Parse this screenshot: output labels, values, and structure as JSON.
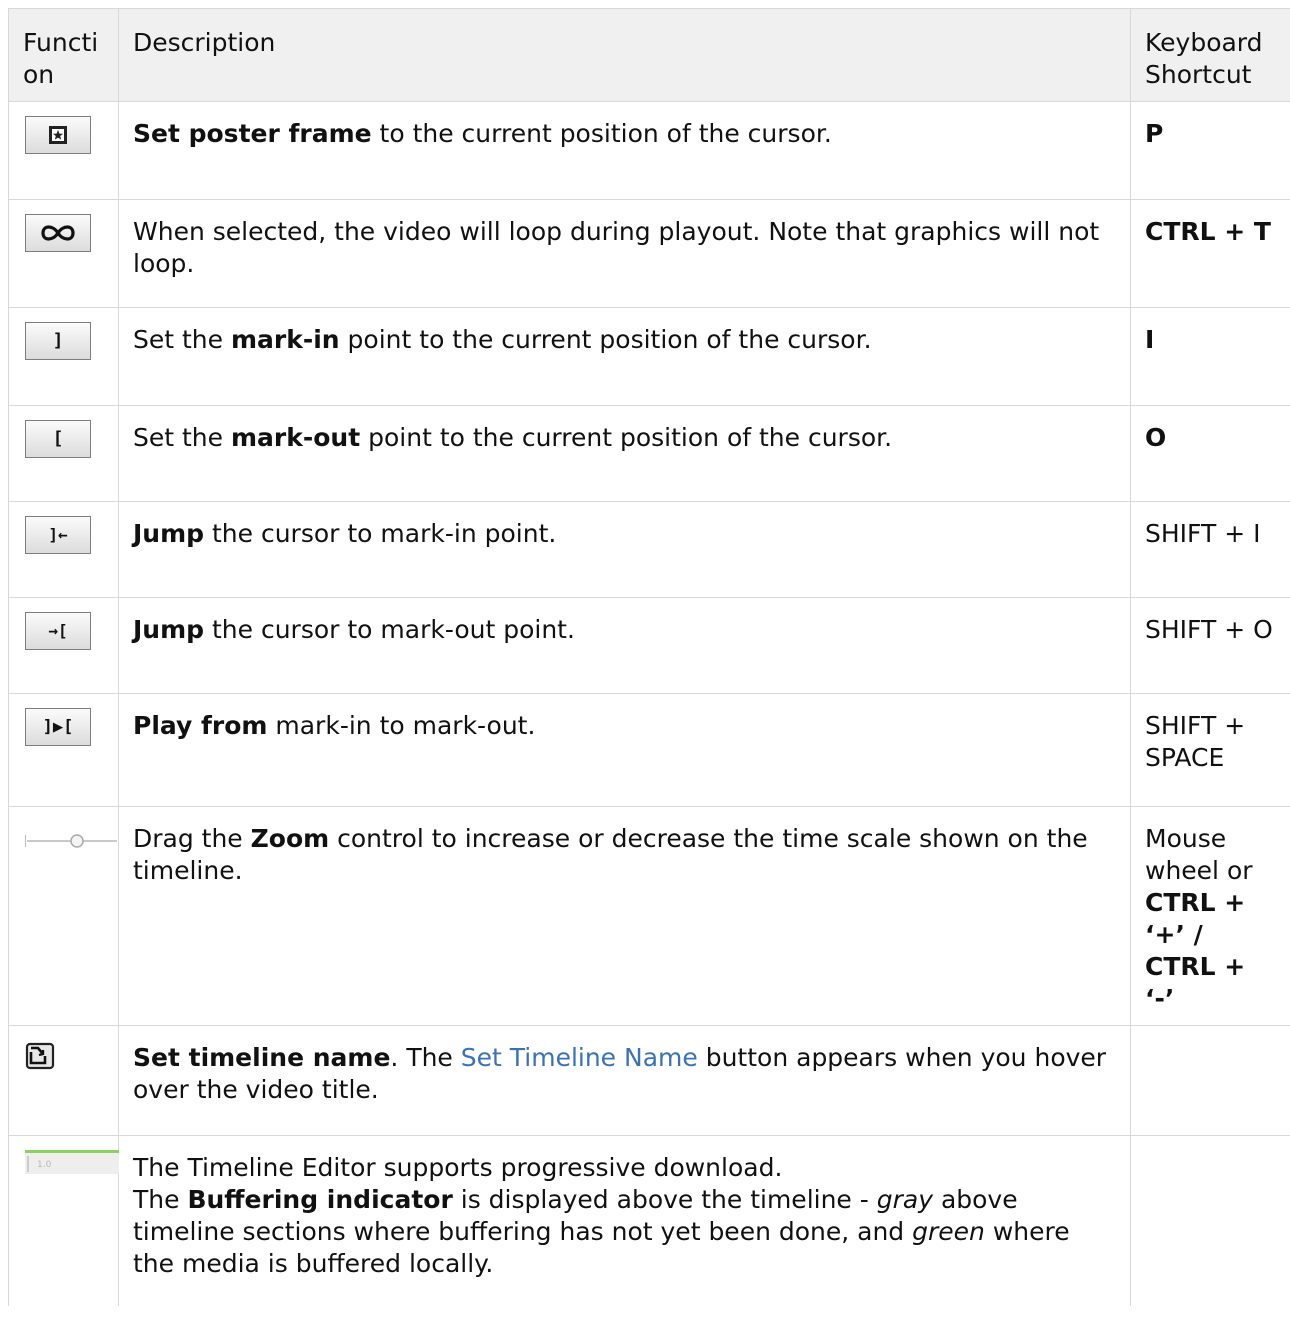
{
  "header": {
    "function": "Function",
    "description": "Description",
    "shortcut": "Keyboard Shortcut"
  },
  "rows": [
    {
      "icon": "poster-frame-icon",
      "desc": [
        {
          "t": "Set poster frame",
          "b": true
        },
        {
          "t": " to the current position of the cursor."
        }
      ],
      "shortcut": [
        {
          "t": "P",
          "b": true
        }
      ]
    },
    {
      "icon": "loop-icon",
      "desc": [
        {
          "t": "When selected, the video will loop during playout. Note that graphics will not loop."
        }
      ],
      "shortcut": [
        {
          "t": "CTRL + T",
          "b": true
        }
      ]
    },
    {
      "icon": "mark-in-icon",
      "desc": [
        {
          "t": "Set the "
        },
        {
          "t": "mark-in",
          "b": true
        },
        {
          "t": " point to the current position of the cursor."
        }
      ],
      "shortcut": [
        {
          "t": "I",
          "b": true
        }
      ]
    },
    {
      "icon": "mark-out-icon",
      "desc": [
        {
          "t": "Set the "
        },
        {
          "t": "mark-out",
          "b": true
        },
        {
          "t": " point to the current position of the cursor."
        }
      ],
      "shortcut": [
        {
          "t": "O",
          "b": true
        }
      ]
    },
    {
      "icon": "jump-to-mark-in-icon",
      "desc": [
        {
          "t": "Jump",
          "b": true
        },
        {
          "t": " the cursor to mark-in point."
        }
      ],
      "shortcut": [
        {
          "t": "SHIFT + I"
        }
      ]
    },
    {
      "icon": "jump-to-mark-out-icon",
      "desc": [
        {
          "t": "Jump",
          "b": true
        },
        {
          "t": " the cursor to mark-out point."
        }
      ],
      "shortcut": [
        {
          "t": "SHIFT + O"
        }
      ]
    },
    {
      "icon": "play-from-mark-in-to-mark-out-icon",
      "desc": [
        {
          "t": "Play from",
          "b": true
        },
        {
          "t": " mark-in to mark-out."
        }
      ],
      "shortcut": [
        {
          "t": "SHIFT + SPACE"
        }
      ]
    },
    {
      "icon": "zoom-slider-icon",
      "desc": [
        {
          "t": "Drag the "
        },
        {
          "t": "Zoom",
          "b": true
        },
        {
          "t": " control to increase or decrease the time scale shown on the timeline."
        }
      ],
      "shortcut": [
        {
          "t": "Mouse wheel or "
        },
        {
          "t": "CTRL + ‘+’ / CTRL + ‘-’",
          "b": true
        }
      ]
    },
    {
      "icon": "set-timeline-name-icon",
      "desc": [
        {
          "t": "Set timeline name",
          "b": true
        },
        {
          "t": ". The "
        },
        {
          "t": "Set Timeline Name",
          "link": true
        },
        {
          "t": " button appears when you hover over the video title."
        }
      ],
      "shortcut": []
    },
    {
      "icon": "buffering-indicator-icon",
      "icon_label": "1.0",
      "desc": [
        {
          "t": "The Timeline Editor supports progressive download."
        },
        {
          "br": true
        },
        {
          "t": "The "
        },
        {
          "t": "Buffering indicator",
          "b": true
        },
        {
          "t": " is displayed above the timeline - "
        },
        {
          "t": "gray",
          "i": true
        },
        {
          "t": " above timeline sections where buffering has not yet been done, and "
        },
        {
          "t": "green",
          "i": true
        },
        {
          "t": " where the media is buffered locally."
        }
      ],
      "shortcut": []
    }
  ]
}
